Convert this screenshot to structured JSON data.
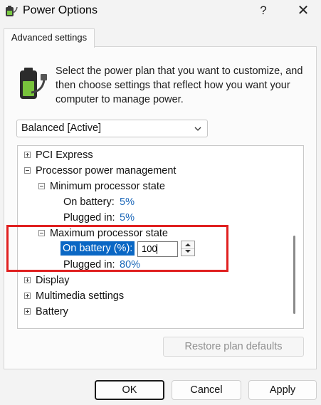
{
  "window": {
    "title": "Power Options",
    "help_label": "?",
    "close_label": "✕"
  },
  "tab": {
    "label": "Advanced settings"
  },
  "description": "Select the power plan that you want to customize, and then choose settings that reflect how you want your computer to manage power.",
  "plan_select": {
    "value": "Balanced [Active]"
  },
  "tree": {
    "pci_express": "PCI Express",
    "processor_power_management": "Processor power management",
    "min_state": {
      "label": "Minimum processor state",
      "on_battery_label": "On battery:",
      "on_battery_value": "5%",
      "plugged_in_label": "Plugged in:",
      "plugged_in_value": "5%"
    },
    "max_state": {
      "label": "Maximum processor state",
      "on_battery_label": "On battery (%):",
      "on_battery_input": "100",
      "plugged_in_label": "Plugged in:",
      "plugged_in_value": "80%"
    },
    "display": "Display",
    "multimedia": "Multimedia settings",
    "battery": "Battery"
  },
  "buttons": {
    "restore": "Restore plan defaults",
    "ok": "OK",
    "cancel": "Cancel",
    "apply": "Apply"
  },
  "colors": {
    "selection": "#0a67c4",
    "value_link": "#1a66b8",
    "annotation": "#e02020"
  }
}
